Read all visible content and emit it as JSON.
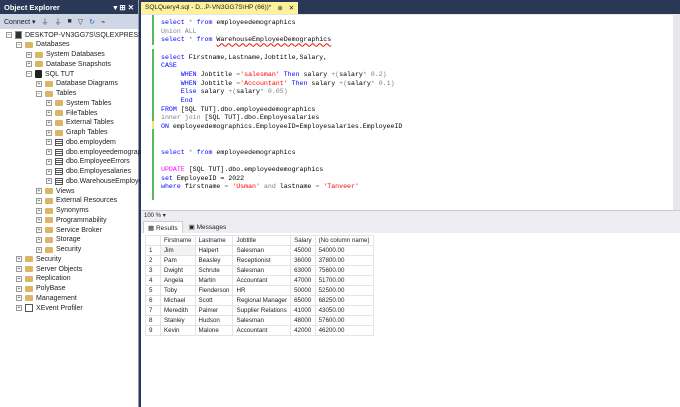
{
  "object_explorer": {
    "title": "Object Explorer",
    "header_controls": "▾ ⊞ ✕",
    "connect": "Connect ▾",
    "nodes": [
      {
        "label": "DESKTOP-VN3GG7S\\SQLEXPRESS (SQL",
        "level": 0,
        "icon": "server-icon",
        "exp": "−"
      },
      {
        "label": "Databases",
        "level": 1,
        "icon": "folder-icon",
        "exp": "−"
      },
      {
        "label": "System Databases",
        "level": 2,
        "icon": "folder-icon",
        "exp": "+"
      },
      {
        "label": "Database Snapshots",
        "level": 2,
        "icon": "folder-icon",
        "exp": "+"
      },
      {
        "label": "SQL TUT",
        "level": 2,
        "icon": "database-icon",
        "exp": "−"
      },
      {
        "label": "Database Diagrams",
        "level": 3,
        "icon": "folder-icon",
        "exp": "+"
      },
      {
        "label": "Tables",
        "level": 3,
        "icon": "folder-icon",
        "exp": "−"
      },
      {
        "label": "System Tables",
        "level": 4,
        "icon": "folder-icon",
        "exp": "+"
      },
      {
        "label": "FileTables",
        "level": 4,
        "icon": "folder-icon",
        "exp": "+"
      },
      {
        "label": "External Tables",
        "level": 4,
        "icon": "folder-icon",
        "exp": "+"
      },
      {
        "label": "Graph Tables",
        "level": 4,
        "icon": "folder-icon",
        "exp": "+"
      },
      {
        "label": "dbo.employdem",
        "level": 4,
        "icon": "table-icon",
        "exp": "+"
      },
      {
        "label": "dbo.employeedemograp",
        "level": 4,
        "icon": "table-icon",
        "exp": "+"
      },
      {
        "label": "dbo.EmployeeErrors",
        "level": 4,
        "icon": "table-icon",
        "exp": "+"
      },
      {
        "label": "dbo.Employesalaries",
        "level": 4,
        "icon": "table-icon",
        "exp": "+"
      },
      {
        "label": "dbo.WarehouseEmploye",
        "level": 4,
        "icon": "table-icon",
        "exp": "+"
      },
      {
        "label": "Views",
        "level": 3,
        "icon": "folder-icon",
        "exp": "+"
      },
      {
        "label": "External Resources",
        "level": 3,
        "icon": "folder-icon",
        "exp": "+"
      },
      {
        "label": "Synonyms",
        "level": 3,
        "icon": "folder-icon",
        "exp": "+"
      },
      {
        "label": "Programmability",
        "level": 3,
        "icon": "folder-icon",
        "exp": "+"
      },
      {
        "label": "Service Broker",
        "level": 3,
        "icon": "folder-icon",
        "exp": "+"
      },
      {
        "label": "Storage",
        "level": 3,
        "icon": "folder-icon",
        "exp": "+"
      },
      {
        "label": "Security",
        "level": 3,
        "icon": "folder-icon",
        "exp": "+"
      },
      {
        "label": "Security",
        "level": 1,
        "icon": "folder-icon",
        "exp": "+"
      },
      {
        "label": "Server Objects",
        "level": 1,
        "icon": "folder-icon",
        "exp": "+"
      },
      {
        "label": "Replication",
        "level": 1,
        "icon": "folder-icon",
        "exp": "+"
      },
      {
        "label": "PolyBase",
        "level": 1,
        "icon": "folder-icon",
        "exp": "+"
      },
      {
        "label": "Management",
        "level": 1,
        "icon": "folder-icon",
        "exp": "+"
      },
      {
        "label": "XEvent Profiler",
        "level": 1,
        "icon": "xevent-icon",
        "exp": "+"
      }
    ]
  },
  "editor": {
    "tab_title": "SQLQuery4.sql - D...P-VN3GG7S\\HP (66))*",
    "tab_pin": "⊕",
    "tab_close": "✕",
    "zoom": "100 %",
    "lines": [
      [
        0,
        [
          [
            "select",
            "kw"
          ],
          [
            " * ",
            "gr"
          ],
          [
            "from",
            "kw"
          ],
          [
            " employeedemographics",
            "tx"
          ]
        ]
      ],
      [
        1,
        [
          [
            "Union ALL",
            "gr"
          ]
        ]
      ],
      [
        2,
        [
          [
            "select",
            "kw"
          ],
          [
            " * ",
            "gr"
          ],
          [
            "from",
            "kw"
          ],
          [
            " ",
            "tx"
          ],
          [
            "WarehouseEmployeeDemographics",
            "sq"
          ]
        ]
      ],
      [
        4,
        [
          [
            "select",
            "kw"
          ],
          [
            " Firstname,Lastname,Jobtitle,Salary,",
            "tx"
          ]
        ]
      ],
      [
        5,
        [
          [
            "CASE",
            "kw"
          ]
        ]
      ],
      [
        6,
        [
          [
            "     WHEN",
            "kw"
          ],
          [
            " Jobtitle ",
            "tx"
          ],
          [
            "=",
            "gr"
          ],
          [
            "'salesman'",
            "str"
          ],
          [
            " Then",
            "kw"
          ],
          [
            " salary ",
            "tx"
          ],
          [
            "+(",
            "gr"
          ],
          [
            "salary",
            "tx"
          ],
          [
            "* 0.2)",
            "gr"
          ]
        ]
      ],
      [
        7,
        [
          [
            "     WHEN",
            "kw"
          ],
          [
            " Jobtitle ",
            "tx"
          ],
          [
            "=",
            "gr"
          ],
          [
            "'Accountant'",
            "str"
          ],
          [
            " Then",
            "kw"
          ],
          [
            " salary ",
            "tx"
          ],
          [
            "+(",
            "gr"
          ],
          [
            "salary",
            "tx"
          ],
          [
            "* 0.1)",
            "gr"
          ]
        ]
      ],
      [
        8,
        [
          [
            "     Else",
            "kw"
          ],
          [
            " salary ",
            "tx"
          ],
          [
            "+(",
            "gr"
          ],
          [
            "salary",
            "tx"
          ],
          [
            "* 0.05)",
            "gr"
          ]
        ]
      ],
      [
        9,
        [
          [
            "     End",
            "kw"
          ]
        ]
      ],
      [
        10,
        [
          [
            "FROM",
            "kw"
          ],
          [
            " [SQL TUT].dbo.employeedemographics",
            "tx"
          ]
        ]
      ],
      [
        11,
        [
          [
            "inner join",
            "gr"
          ],
          [
            " [SQL TUT].dbo.Employesalaries",
            "tx"
          ]
        ]
      ],
      [
        12,
        [
          [
            "ON",
            "kw"
          ],
          [
            " employeedemographics.EmployeeID=Employesalaries.EmployeeID",
            "tx"
          ]
        ]
      ],
      [
        15,
        [
          [
            "select",
            "kw"
          ],
          [
            " * ",
            "gr"
          ],
          [
            "from",
            "kw"
          ],
          [
            " employeedemographics",
            "tx"
          ]
        ]
      ],
      [
        17,
        [
          [
            "UPDATE",
            "pk"
          ],
          [
            " [SQL TUT].dbo.employeedemographics",
            "tx"
          ]
        ]
      ],
      [
        18,
        [
          [
            "set",
            "kw"
          ],
          [
            " EmployeeID ",
            "tx"
          ],
          [
            "= 2022",
            "tx"
          ]
        ]
      ],
      [
        19,
        [
          [
            "where",
            "kw"
          ],
          [
            " firstname ",
            "tx"
          ],
          [
            "=",
            "gr"
          ],
          [
            " 'Usman'",
            "str"
          ],
          [
            " and",
            "gr"
          ],
          [
            " lastname ",
            "tx"
          ],
          [
            "=",
            "gr"
          ],
          [
            " 'Tanveer'",
            "str"
          ]
        ]
      ]
    ]
  },
  "results": {
    "tabs": [
      "Results",
      "Messages"
    ],
    "columns": [
      "",
      "Firstname",
      "Lastname",
      "Jobtitle",
      "Salary",
      "(No column name)"
    ],
    "rows": [
      [
        "1",
        "Jim",
        "Halpert",
        "Salesman",
        "45000",
        "54000.00"
      ],
      [
        "2",
        "Pam",
        "Beasley",
        "Receptionist",
        "36000",
        "37800.00"
      ],
      [
        "3",
        "Dwight",
        "Schrute",
        "Salesman",
        "63000",
        "75600.00"
      ],
      [
        "4",
        "Angela",
        "Martin",
        "Accountant",
        "47000",
        "51700.00"
      ],
      [
        "5",
        "Toby",
        "Flenderson",
        "HR",
        "50000",
        "52500.00"
      ],
      [
        "6",
        "Michael",
        "Scott",
        "Regional Manager",
        "65000",
        "68250.00"
      ],
      [
        "7",
        "Meredith",
        "Palmer",
        "Supplier Relations",
        "41000",
        "43050.00"
      ],
      [
        "8",
        "Stanley",
        "Hudson",
        "Salesman",
        "48000",
        "57600.00"
      ],
      [
        "9",
        "Kevin",
        "Malone",
        "Accountant",
        "42000",
        "46200.00"
      ]
    ]
  }
}
